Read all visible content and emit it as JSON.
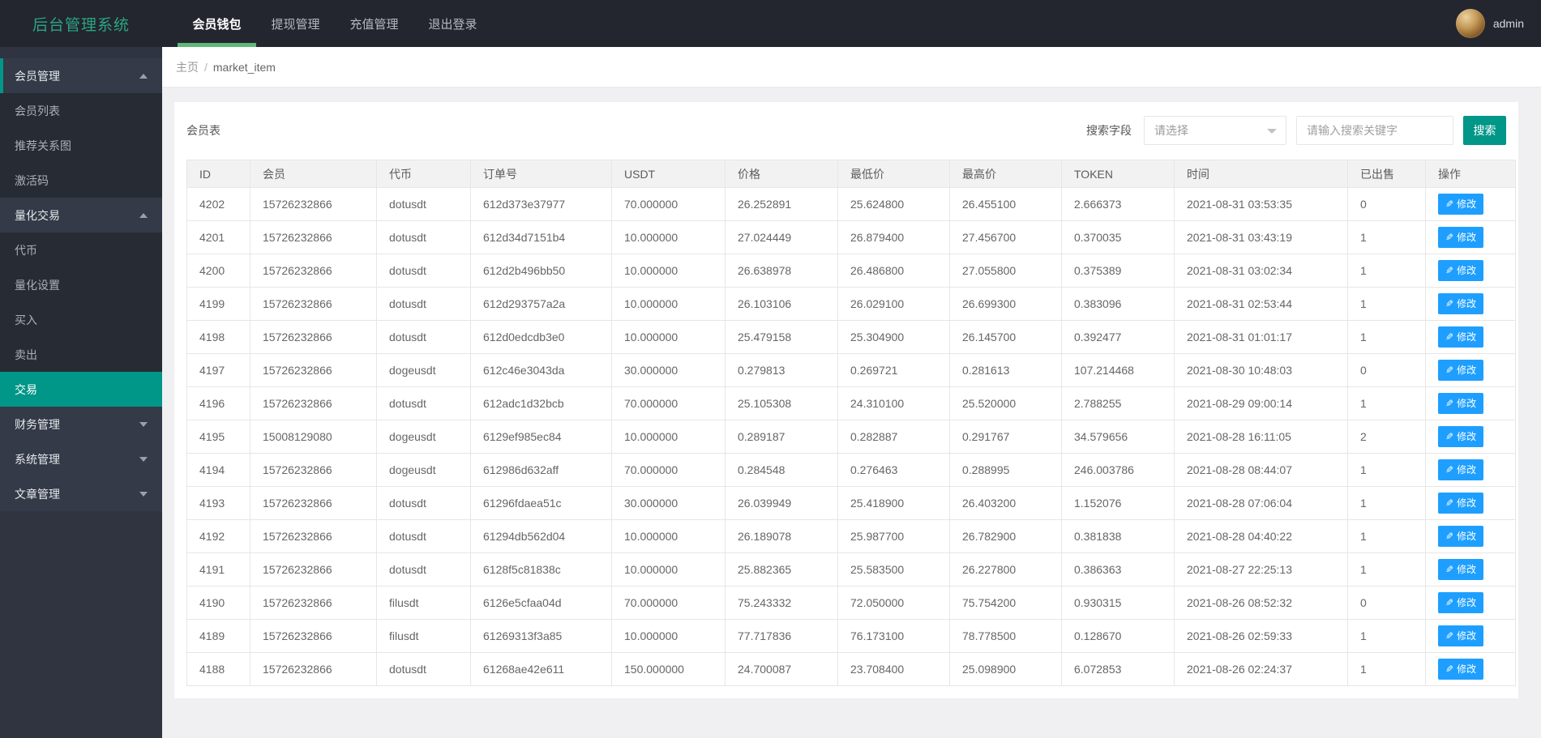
{
  "app": {
    "brand": "后台管理系统",
    "admin_label": "admin"
  },
  "navbar": {
    "tabs": [
      {
        "label": "会员钱包",
        "active": true
      },
      {
        "label": "提现管理",
        "active": false
      },
      {
        "label": "充值管理",
        "active": false
      },
      {
        "label": "退出登录",
        "active": false
      }
    ]
  },
  "sidebar": {
    "items": [
      {
        "label": "会员管理",
        "type": "header",
        "arrow": "up",
        "indicator": true,
        "active": false
      },
      {
        "label": "会员列表",
        "type": "child",
        "arrow": "",
        "indicator": false,
        "active": false
      },
      {
        "label": "推荐关系图",
        "type": "child",
        "arrow": "",
        "indicator": false,
        "active": false
      },
      {
        "label": "激活码",
        "type": "child",
        "arrow": "",
        "indicator": false,
        "active": false
      },
      {
        "label": "量化交易",
        "type": "header",
        "arrow": "up",
        "indicator": false,
        "active": false
      },
      {
        "label": "代币",
        "type": "child",
        "arrow": "",
        "indicator": false,
        "active": false
      },
      {
        "label": "量化设置",
        "type": "child",
        "arrow": "",
        "indicator": false,
        "active": false
      },
      {
        "label": "买入",
        "type": "child",
        "arrow": "",
        "indicator": false,
        "active": false
      },
      {
        "label": "卖出",
        "type": "child",
        "arrow": "",
        "indicator": false,
        "active": false
      },
      {
        "label": "交易",
        "type": "child",
        "arrow": "",
        "indicator": false,
        "active": true
      },
      {
        "label": "财务管理",
        "type": "header",
        "arrow": "down",
        "indicator": false,
        "active": false
      },
      {
        "label": "系统管理",
        "type": "header",
        "arrow": "down",
        "indicator": false,
        "active": false
      },
      {
        "label": "文章管理",
        "type": "header",
        "arrow": "down",
        "indicator": false,
        "active": false
      }
    ]
  },
  "breadcrumb": {
    "home": "主页",
    "separator": "/",
    "current": "market_item"
  },
  "panel": {
    "title": "会员表"
  },
  "search": {
    "field_label": "搜索字段",
    "select_placeholder": "请选择",
    "input_placeholder": "请输入搜索关键字",
    "button_label": "搜索"
  },
  "icons": {
    "edit": "✎"
  },
  "colors": {
    "accent_green": "#5FB878",
    "teal": "#009688",
    "edit_blue": "#1E9FFF",
    "brand_green": "#2aa582"
  },
  "table": {
    "columns": [
      "ID",
      "会员",
      "代币",
      "订单号",
      "USDT",
      "价格",
      "最低价",
      "最高价",
      "TOKEN",
      "时间",
      "已出售",
      "操作"
    ],
    "edit_label": "修改",
    "rows": [
      [
        "4202",
        "15726232866",
        "dotusdt",
        "612d373e37977",
        "70.000000",
        "26.252891",
        "25.624800",
        "26.455100",
        "2.666373",
        "2021-08-31 03:53:35",
        "0"
      ],
      [
        "4201",
        "15726232866",
        "dotusdt",
        "612d34d7151b4",
        "10.000000",
        "27.024449",
        "26.879400",
        "27.456700",
        "0.370035",
        "2021-08-31 03:43:19",
        "1"
      ],
      [
        "4200",
        "15726232866",
        "dotusdt",
        "612d2b496bb50",
        "10.000000",
        "26.638978",
        "26.486800",
        "27.055800",
        "0.375389",
        "2021-08-31 03:02:34",
        "1"
      ],
      [
        "4199",
        "15726232866",
        "dotusdt",
        "612d293757a2a",
        "10.000000",
        "26.103106",
        "26.029100",
        "26.699300",
        "0.383096",
        "2021-08-31 02:53:44",
        "1"
      ],
      [
        "4198",
        "15726232866",
        "dotusdt",
        "612d0edcdb3e0",
        "10.000000",
        "25.479158",
        "25.304900",
        "26.145700",
        "0.392477",
        "2021-08-31 01:01:17",
        "1"
      ],
      [
        "4197",
        "15726232866",
        "dogeusdt",
        "612c46e3043da",
        "30.000000",
        "0.279813",
        "0.269721",
        "0.281613",
        "107.214468",
        "2021-08-30 10:48:03",
        "0"
      ],
      [
        "4196",
        "15726232866",
        "dotusdt",
        "612adc1d32bcb",
        "70.000000",
        "25.105308",
        "24.310100",
        "25.520000",
        "2.788255",
        "2021-08-29 09:00:14",
        "1"
      ],
      [
        "4195",
        "15008129080",
        "dogeusdt",
        "6129ef985ec84",
        "10.000000",
        "0.289187",
        "0.282887",
        "0.291767",
        "34.579656",
        "2021-08-28 16:11:05",
        "2"
      ],
      [
        "4194",
        "15726232866",
        "dogeusdt",
        "612986d632aff",
        "70.000000",
        "0.284548",
        "0.276463",
        "0.288995",
        "246.003786",
        "2021-08-28 08:44:07",
        "1"
      ],
      [
        "4193",
        "15726232866",
        "dotusdt",
        "61296fdaea51c",
        "30.000000",
        "26.039949",
        "25.418900",
        "26.403200",
        "1.152076",
        "2021-08-28 07:06:04",
        "1"
      ],
      [
        "4192",
        "15726232866",
        "dotusdt",
        "61294db562d04",
        "10.000000",
        "26.189078",
        "25.987700",
        "26.782900",
        "0.381838",
        "2021-08-28 04:40:22",
        "1"
      ],
      [
        "4191",
        "15726232866",
        "dotusdt",
        "6128f5c81838c",
        "10.000000",
        "25.882365",
        "25.583500",
        "26.227800",
        "0.386363",
        "2021-08-27 22:25:13",
        "1"
      ],
      [
        "4190",
        "15726232866",
        "filusdt",
        "6126e5cfaa04d",
        "70.000000",
        "75.243332",
        "72.050000",
        "75.754200",
        "0.930315",
        "2021-08-26 08:52:32",
        "0"
      ],
      [
        "4189",
        "15726232866",
        "filusdt",
        "61269313f3a85",
        "10.000000",
        "77.717836",
        "76.173100",
        "78.778500",
        "0.128670",
        "2021-08-26 02:59:33",
        "1"
      ],
      [
        "4188",
        "15726232866",
        "dotusdt",
        "61268ae42e611",
        "150.000000",
        "24.700087",
        "23.708400",
        "25.098900",
        "6.072853",
        "2021-08-26 02:24:37",
        "1"
      ]
    ]
  }
}
